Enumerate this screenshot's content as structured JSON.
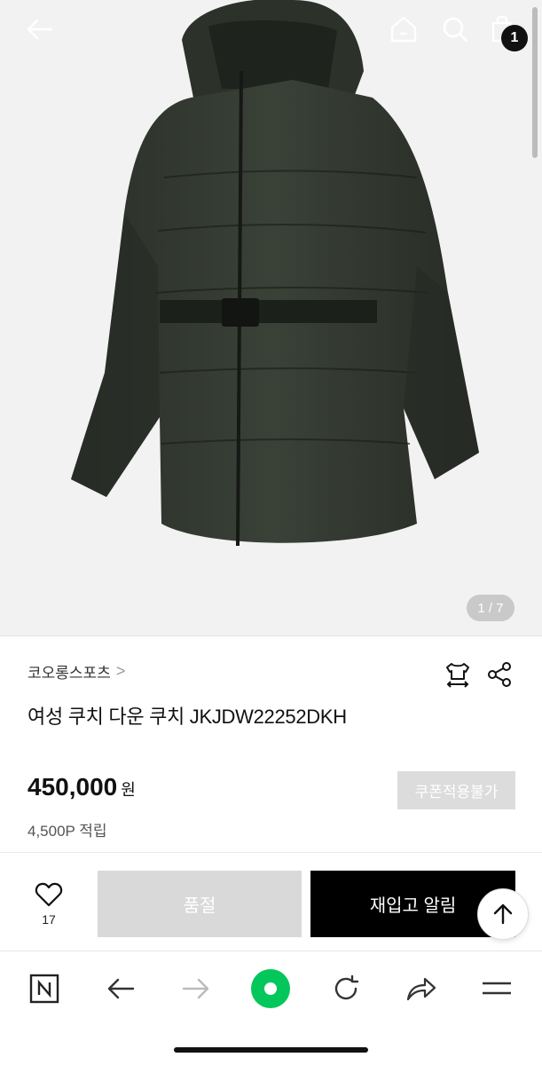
{
  "product_image": {
    "pager": "1 / 7"
  },
  "header": {
    "cart_count": "1"
  },
  "product": {
    "brand": "코오롱스포츠",
    "brand_chevron": ">",
    "title": "여성 쿠치 다운 쿠치 JKJDW22252DKH",
    "price": "450,000",
    "price_unit": "원",
    "coupon_label": "쿠폰적용불가",
    "points": "4,500P 적립"
  },
  "actions": {
    "like_count": "17",
    "soldout_label": "품절",
    "restock_label": "재입고 알림"
  },
  "icons": {
    "back": "back-arrow-icon",
    "home": "home-icon",
    "search": "search-icon",
    "cart": "shopping-bag-icon",
    "size": "size-guide-icon",
    "share": "share-icon",
    "heart": "heart-icon",
    "to_top": "arrow-up-icon"
  },
  "browser": {
    "icons": [
      "naver-n-icon",
      "back-icon",
      "forward-icon",
      "green-dot-icon",
      "reload-icon",
      "share-icon",
      "menu-icon"
    ]
  },
  "colors": {
    "accent_green": "#03c75a",
    "primary_black": "#000000",
    "disabled_gray": "#d9d9d9"
  }
}
